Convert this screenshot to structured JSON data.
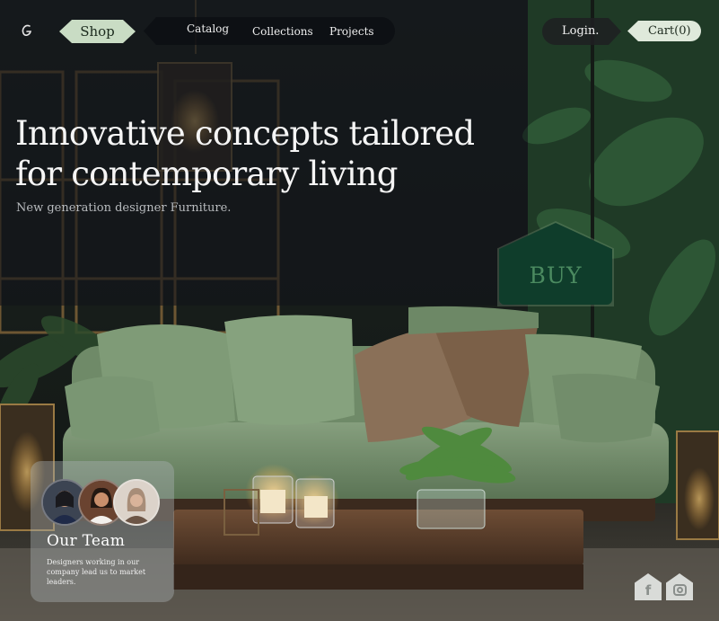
{
  "nav": {
    "logo_icon": "logo-mark-icon",
    "shop_label": "Shop",
    "links": [
      "Catalog",
      "Collections",
      "Projects"
    ],
    "login_label": "Login.",
    "cart_label": "Cart(0)"
  },
  "hero": {
    "title_line1": "Innovative concepts tailored",
    "title_line2": "for contemporary living",
    "subtitle": "New generation designer Furniture."
  },
  "buy": {
    "label": "BUY"
  },
  "team": {
    "title": "Our Team",
    "description": "Designers working in our company lead us to market leaders."
  },
  "social": {
    "facebook_icon": "facebook-icon",
    "instagram_icon": "instagram-icon"
  },
  "colors": {
    "accent_green": "#c9dcc4",
    "buy_green": "#0f3d2b",
    "sofa_green": "#7a9873",
    "panel_dark": "#12141a"
  }
}
